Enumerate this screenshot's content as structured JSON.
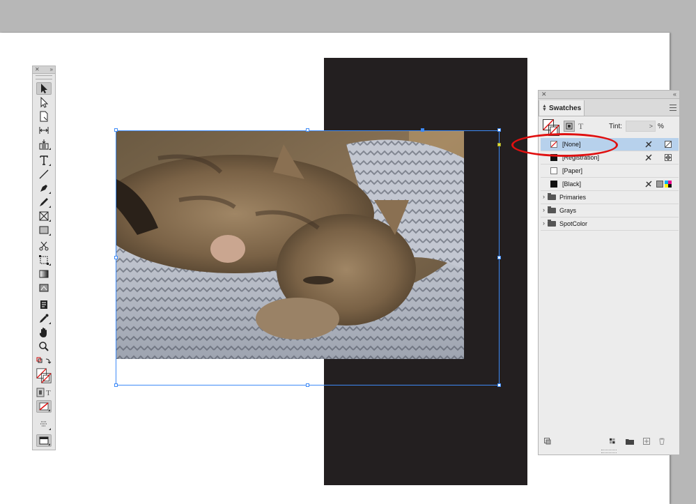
{
  "swatches_panel": {
    "title": "Swatches",
    "tint_label": "Tint:",
    "tint_value": ">",
    "tint_unit": "%",
    "swatches": [
      {
        "name": "[None]",
        "selected": true
      },
      {
        "name": "[Registration]",
        "selected": false
      },
      {
        "name": "[Paper]",
        "selected": false
      },
      {
        "name": "[Black]",
        "selected": false
      }
    ],
    "groups": [
      {
        "name": "Primaries"
      },
      {
        "name": "Grays"
      },
      {
        "name": "SpotColor"
      }
    ]
  },
  "tools_panel": {
    "tools": [
      "selection-tool",
      "direct-selection-tool",
      "page-tool",
      "gap-tool",
      "content-collector-tool",
      "type-tool",
      "line-tool",
      "pen-tool",
      "pencil-tool",
      "rectangle-frame-tool",
      "rectangle-tool",
      "scissors-tool",
      "free-transform-tool",
      "gradient-swatch-tool",
      "gradient-feather-tool",
      "note-tool",
      "eyedropper-tool",
      "hand-tool",
      "zoom-tool"
    ],
    "active_tool": "selection-tool",
    "type_glyph": "T"
  },
  "colors": {
    "selection": "#3d8af7",
    "highlight_ellipse": "#e01010",
    "selected_row": "#b7d1ec",
    "dark_rectangle": "#231f20"
  }
}
